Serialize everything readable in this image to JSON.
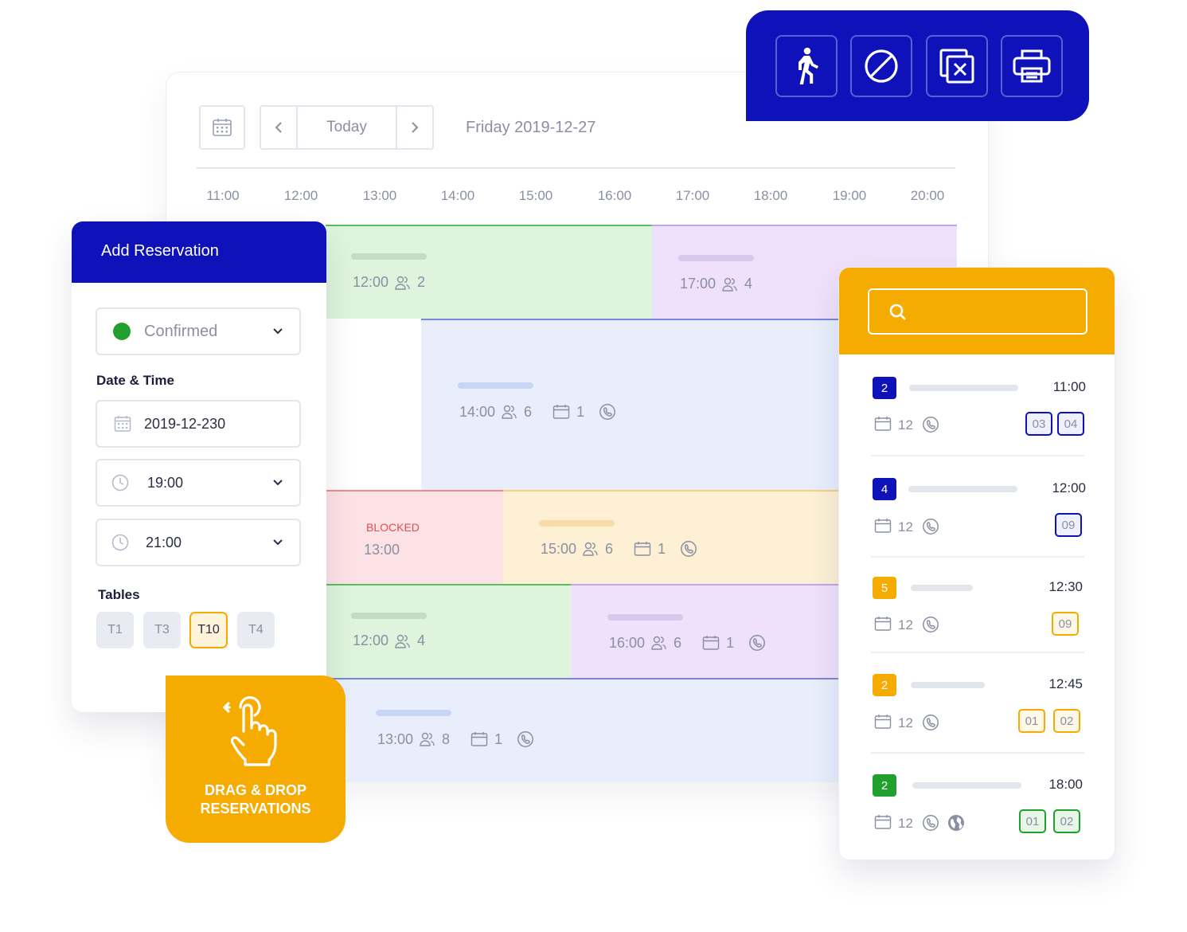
{
  "colors": {
    "brand_blue": "#0e12b8",
    "accent_orange": "#f6ab00",
    "green": "#22a02e"
  },
  "toolbar": {
    "icons": [
      "walk-in-icon",
      "block-icon",
      "cancel-icon",
      "print-icon"
    ]
  },
  "nav": {
    "today_label": "Today",
    "date_label": "Friday 2019-12-27"
  },
  "timeline": {
    "hours": [
      "11:00",
      "12:00",
      "13:00",
      "14:00",
      "15:00",
      "16:00",
      "17:00",
      "18:00",
      "19:00",
      "20:00"
    ],
    "reservations": [
      {
        "time": "12:00",
        "guests": "2"
      },
      {
        "time": "17:00",
        "guests": "4"
      },
      {
        "time": "14:00",
        "guests": "6",
        "tables": "1"
      },
      {
        "status": "BLOCKED",
        "time": "13:00"
      },
      {
        "time": "15:00",
        "guests": "6",
        "tables": "1"
      },
      {
        "time": "12:00",
        "guests": "4"
      },
      {
        "time": "16:00",
        "guests": "6",
        "tables": "1"
      },
      {
        "time": "13:00",
        "guests": "8",
        "tables": "1"
      }
    ]
  },
  "add_reservation": {
    "title": "Add Reservation",
    "status": "Confirmed",
    "date_time_label": "Date & Time",
    "date": "2019-12-230",
    "start_time": "19:00",
    "end_time": "21:00",
    "tables_label": "Tables",
    "tables": [
      "T1",
      "T3",
      "T10",
      "T4"
    ],
    "selected_table": "T10"
  },
  "drag_drop": {
    "line1": "DRAG & DROP",
    "line2": "RESERVATIONS"
  },
  "search": {
    "placeholder": ""
  },
  "list": [
    {
      "badge": "2",
      "time": "11:00",
      "count": "12",
      "tables": [
        "03",
        "04"
      ]
    },
    {
      "badge": "4",
      "time": "12:00",
      "count": "12",
      "tables": [
        "09"
      ]
    },
    {
      "badge": "5",
      "time": "12:30",
      "count": "12",
      "tables": [
        "09"
      ]
    },
    {
      "badge": "2",
      "time": "12:45",
      "count": "12",
      "tables": [
        "01",
        "02"
      ]
    },
    {
      "badge": "2",
      "time": "18:00",
      "count": "12",
      "tables": [
        "01",
        "02"
      ]
    }
  ]
}
